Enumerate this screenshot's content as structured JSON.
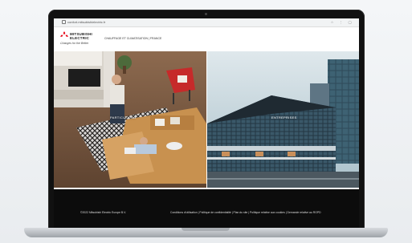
{
  "browser": {
    "url": "confort.mitsubishielectric.fr"
  },
  "header": {
    "brand_line1": "MITSUBISHI",
    "brand_line2": "ELECTRIC",
    "tagline": "Changes for the Better",
    "nav_text": "CHAUFFAGE ET CLIMATISATION | FRANCE"
  },
  "panels": {
    "left_label": "PARTICULIERS",
    "right_label": "ENTREPRISES"
  },
  "footer": {
    "copyright": "©2022 Mitsubishi Electric Europe B.V.",
    "legal": "Conditions d'utilisation | Politique de confidentialité | Plan du site | Politique relative aux cookies | Demande relative au RGPD"
  },
  "colors": {
    "brand_red": "#e60012",
    "footer_bg": "#0c0c0c"
  }
}
